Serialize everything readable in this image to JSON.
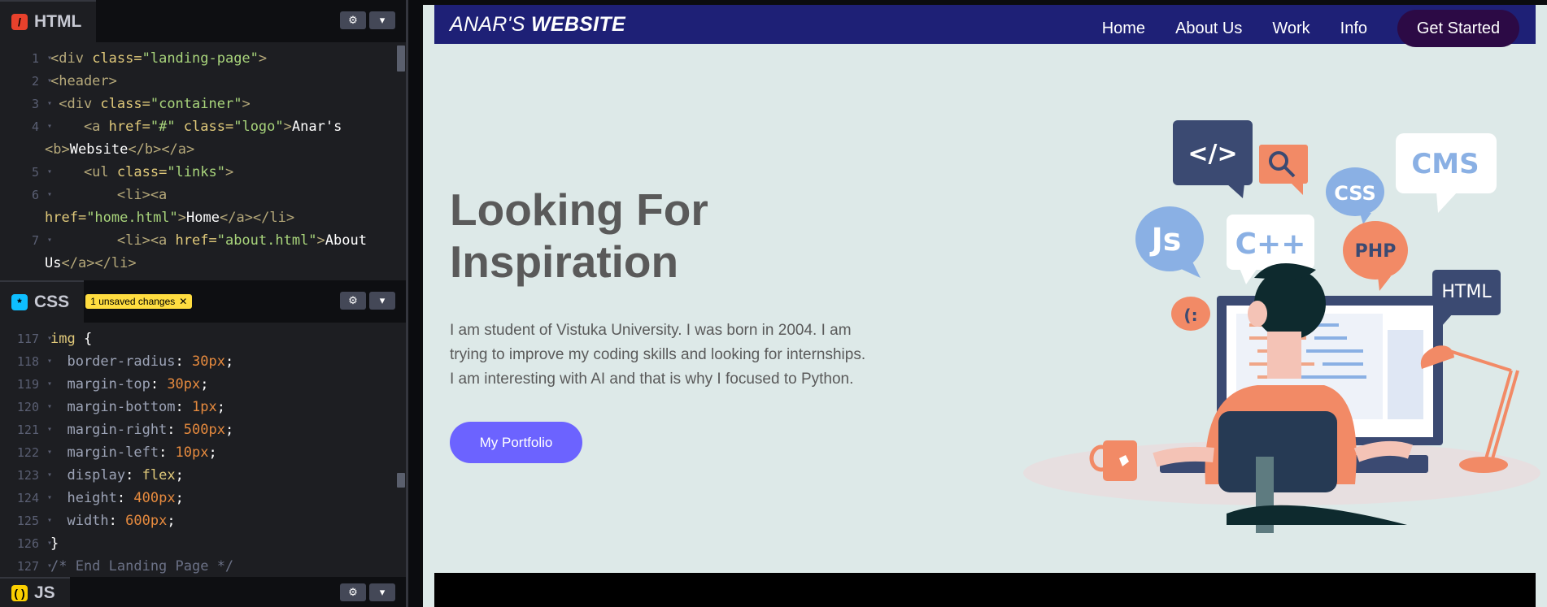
{
  "editor": {
    "html_panel": {
      "tab_label": "HTML",
      "lines": [
        {
          "n": "1",
          "parts": [
            [
              "tg",
              "<div "
            ],
            [
              "at",
              "class="
            ],
            [
              "sv",
              "\"landing-page\""
            ],
            [
              "tg",
              ">"
            ]
          ]
        },
        {
          "n": "2",
          "parts": [
            [
              "tg",
              "<header>"
            ]
          ]
        },
        {
          "n": "3",
          "parts": [
            [
              "tg",
              " <div "
            ],
            [
              "at",
              "class="
            ],
            [
              "sv",
              "\"container\""
            ],
            [
              "tg",
              ">"
            ]
          ]
        },
        {
          "n": "4",
          "parts": [
            [
              "tg",
              "    <a "
            ],
            [
              "at",
              "href="
            ],
            [
              "sv",
              "\"#\" "
            ],
            [
              "at",
              "class="
            ],
            [
              "sv",
              "\"logo\""
            ],
            [
              "tg",
              ">"
            ],
            [
              "wt",
              "Anar's"
            ]
          ],
          "wrap": [
            [
              "tg",
              "<b>"
            ],
            [
              "wt",
              "Website"
            ],
            [
              "tg",
              "</b></a>"
            ]
          ]
        },
        {
          "n": "5",
          "parts": [
            [
              "tg",
              "    <ul "
            ],
            [
              "at",
              "class="
            ],
            [
              "sv",
              "\"links\""
            ],
            [
              "tg",
              ">"
            ]
          ]
        },
        {
          "n": "6",
          "parts": [
            [
              "tg",
              "        <li><a"
            ]
          ],
          "wrap": [
            [
              "at",
              "href="
            ],
            [
              "sv",
              "\"home.html\""
            ],
            [
              "tg",
              ">"
            ],
            [
              "wt",
              "Home"
            ],
            [
              "tg",
              "</a></li>"
            ]
          ]
        },
        {
          "n": "7",
          "parts": [
            [
              "tg",
              "        <li><a "
            ],
            [
              "at",
              "href="
            ],
            [
              "sv",
              "\"about.html\""
            ],
            [
              "tg",
              ">"
            ],
            [
              "wt",
              "About"
            ]
          ],
          "wrap": [
            [
              "wt",
              "Us"
            ],
            [
              "tg",
              "</a></li>"
            ]
          ]
        }
      ]
    },
    "css_panel": {
      "tab_label": "CSS",
      "unsaved_label": "1 unsaved changes",
      "lines": [
        {
          "n": "117",
          "parts": [
            [
              "sel",
              "img "
            ],
            [
              "wt",
              "{"
            ]
          ]
        },
        {
          "n": "118",
          "parts": [
            [
              "prop",
              "  border-radius"
            ],
            [
              "wt",
              ": "
            ],
            [
              "num",
              "30px"
            ],
            [
              "wt",
              ";"
            ]
          ]
        },
        {
          "n": "119",
          "parts": [
            [
              "prop",
              "  margin-top"
            ],
            [
              "wt",
              ": "
            ],
            [
              "num",
              "30px"
            ],
            [
              "wt",
              ";"
            ]
          ]
        },
        {
          "n": "120",
          "parts": [
            [
              "prop",
              "  margin-bottom"
            ],
            [
              "wt",
              ": "
            ],
            [
              "num",
              "1px"
            ],
            [
              "wt",
              ";"
            ]
          ]
        },
        {
          "n": "121",
          "parts": [
            [
              "prop",
              "  margin-right"
            ],
            [
              "wt",
              ": "
            ],
            [
              "num",
              "500px"
            ],
            [
              "wt",
              ";"
            ]
          ]
        },
        {
          "n": "122",
          "parts": [
            [
              "prop",
              "  margin-left"
            ],
            [
              "wt",
              ": "
            ],
            [
              "num",
              "10px"
            ],
            [
              "wt",
              ";"
            ]
          ]
        },
        {
          "n": "123",
          "parts": [
            [
              "prop",
              "  display"
            ],
            [
              "wt",
              ": "
            ],
            [
              "kw",
              "flex"
            ],
            [
              "wt",
              ";"
            ]
          ]
        },
        {
          "n": "124",
          "parts": [
            [
              "prop",
              "  height"
            ],
            [
              "wt",
              ": "
            ],
            [
              "num",
              "400px"
            ],
            [
              "wt",
              ";"
            ]
          ]
        },
        {
          "n": "125",
          "parts": [
            [
              "prop",
              "  width"
            ],
            [
              "wt",
              ": "
            ],
            [
              "num",
              "600px"
            ],
            [
              "wt",
              ";"
            ]
          ]
        },
        {
          "n": "126",
          "parts": [
            [
              "wt",
              "}"
            ]
          ]
        },
        {
          "n": "127",
          "parts": [
            [
              "cmt",
              "/* End Landing Page */"
            ]
          ]
        }
      ]
    },
    "js_panel": {
      "tab_label": "JS"
    }
  },
  "preview": {
    "logo_regular": "ANAR'S ",
    "logo_bold": "WEBSITE",
    "nav": [
      "Home",
      "About Us",
      "Work",
      "Info"
    ],
    "cta": "Get Started",
    "hero_title_line1": "Looking For",
    "hero_title_line2": "Inspiration",
    "hero_text": "I am student of Vistuka University. I was born in 2004. I am trying to improve my coding skills and looking for internships. I am interesting with AI and that is why I focused to Python.",
    "portfolio_button": "My Portfolio",
    "bubbles": {
      "code": "</>",
      "js": "Js",
      "cpp": "C++",
      "css": "CSS",
      "cms": "CMS",
      "php": "PHP",
      "html": "HTML",
      "smile": "(:"
    }
  },
  "colors": {
    "navbar": "#1e2076",
    "cta": "#2c0a45",
    "portfolio": "#6c63ff",
    "page_bg": "#dde9e8"
  }
}
